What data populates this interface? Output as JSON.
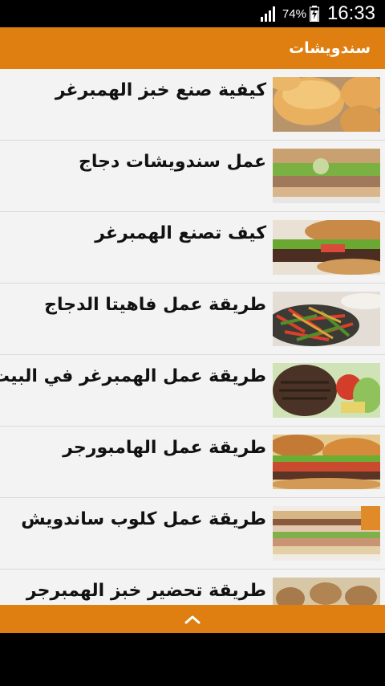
{
  "status_bar": {
    "battery_percent": "74%",
    "time": "16:33",
    "icons": [
      "signal-icon",
      "battery-charging-icon"
    ]
  },
  "app_bar": {
    "title": "سندويشات"
  },
  "recipes": [
    {
      "label": "كيفية صنع خبز الهمبرغر",
      "thumbnail": "burger-buns-photo"
    },
    {
      "label": "عمل سندويشات دجاج",
      "thumbnail": "chicken-sandwich-photo"
    },
    {
      "label": "كيف تصنع الهمبرغر",
      "thumbnail": "hamburger-photo"
    },
    {
      "label": "طريقة عمل فاهيتا الدجاج",
      "thumbnail": "chicken-fajita-photo"
    },
    {
      "label": "طريقة عمل الهمبرغر في البيت",
      "thumbnail": "burger-patty-photo"
    },
    {
      "label": "طريقة عمل الهامبورجر",
      "thumbnail": "hamburger-close-photo"
    },
    {
      "label": "طريقة عمل كلوب ساندويش",
      "thumbnail": "club-sandwich-photo"
    },
    {
      "label": "طريقة تحضير خبز الهمبرجر",
      "thumbnail": "burger-buns-tray-photo"
    }
  ],
  "bottom_bar": {
    "icon": "chevron-up-icon"
  },
  "colors": {
    "accent": "#df7f12",
    "list_background": "#f3f3f3",
    "divider": "#d9d9d9"
  }
}
